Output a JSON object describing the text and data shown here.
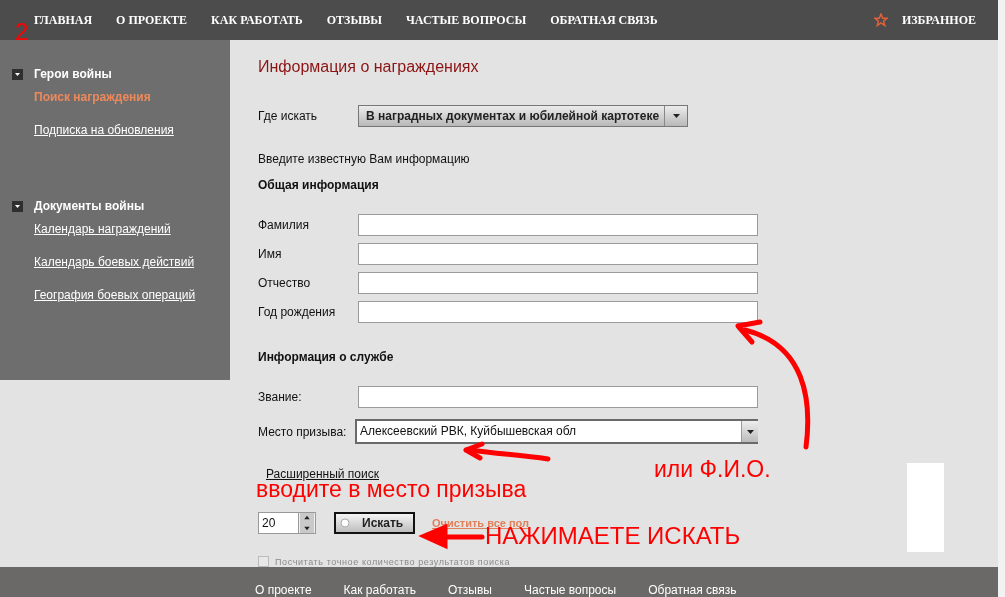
{
  "nav": {
    "items": [
      {
        "label": "ГЛАВНАЯ"
      },
      {
        "label": "О ПРОЕКТЕ"
      },
      {
        "label": "КАК РАБОТАТЬ"
      },
      {
        "label": "ОТЗЫВЫ"
      },
      {
        "label": "ЧАСТЫЕ ВОПРОСЫ"
      },
      {
        "label": "ОБРАТНАЯ СВЯЗЬ"
      }
    ],
    "favorites": "ИЗБРАННОЕ"
  },
  "sidebar": {
    "sections": [
      {
        "title": "Герои войны",
        "expanded": true,
        "items": [
          {
            "label": "Поиск награждения",
            "selected": true
          },
          {
            "label": "Подписка на обновления",
            "selected": false
          }
        ]
      },
      {
        "title": "Документы войны",
        "expanded": true,
        "items": [
          {
            "label": "Календарь награждений",
            "selected": false
          },
          {
            "label": "Календарь боевых действий",
            "selected": false
          },
          {
            "label": "География боевых операций",
            "selected": false
          }
        ]
      }
    ]
  },
  "form": {
    "title": "Информация о награждениях",
    "where": {
      "label": "Где искать",
      "value": "В наградных документах и юбилейной картотеке"
    },
    "intro": "Введите известную Вам информацию",
    "general": {
      "heading": "Общая информация",
      "fields": [
        {
          "label": "Фамилия"
        },
        {
          "label": "Имя"
        },
        {
          "label": "Отчество"
        },
        {
          "label": "Год рождения"
        }
      ]
    },
    "service": {
      "heading": "Информация о службе",
      "rank": {
        "label": "Звание:"
      },
      "place": {
        "label": "Место призыва:",
        "value": "Алексеевский РВК, Куйбышевская обл"
      }
    },
    "advanced": "Расширенный поиск",
    "page_size": "20",
    "search_button": "Искать",
    "clear_link": "Очистить все пол",
    "exact_count": {
      "label": "Посчитать точное количество результатов поиска",
      "checked": false,
      "disabled": true
    }
  },
  "footer": {
    "links": [
      "О проекте",
      "Как работать",
      "Отзывы",
      "Частые вопросы",
      "Обратная связь"
    ]
  },
  "annotations": {
    "number": "2",
    "enter_place": "вводите в место призыва",
    "or_name": "или Ф.И.О.",
    "press_search": "НАЖИМАЕТЕ ИСКАТЬ"
  }
}
